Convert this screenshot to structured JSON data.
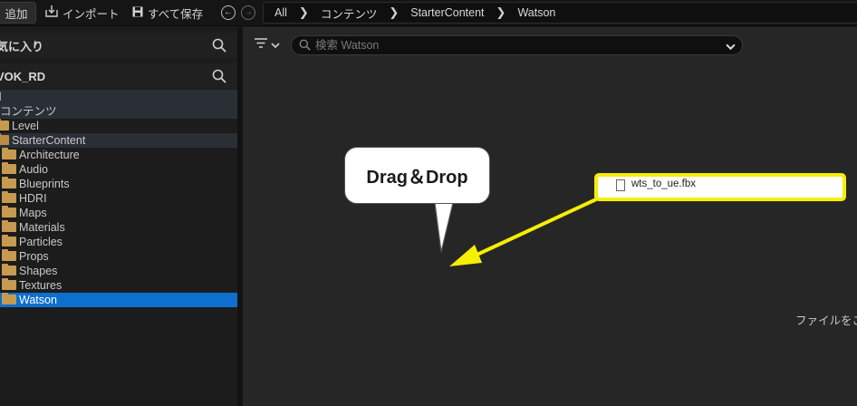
{
  "toolbar": {
    "add_label": "追加",
    "import_label": "インポート",
    "saveall_label": "すべて保存",
    "back_icon": "arrow-left-icon",
    "forward_icon": "arrow-right-icon"
  },
  "breadcrumb": {
    "items": [
      "All",
      "コンテンツ",
      "StarterContent",
      "Watson"
    ],
    "separator": "❯"
  },
  "sidebar": {
    "favorites_title": "気に入り",
    "project_title": "VOK_RD",
    "tree": [
      {
        "label": "ll",
        "type": "root"
      },
      {
        "label": "コンテンツ",
        "type": "root"
      },
      {
        "label": "Level",
        "type": "folder"
      },
      {
        "label": "StarterContent",
        "type": "folder-open"
      },
      {
        "label": "Architecture",
        "type": "folder"
      },
      {
        "label": "Audio",
        "type": "folder"
      },
      {
        "label": "Blueprints",
        "type": "folder"
      },
      {
        "label": "HDRI",
        "type": "folder"
      },
      {
        "label": "Maps",
        "type": "folder"
      },
      {
        "label": "Materials",
        "type": "folder"
      },
      {
        "label": "Particles",
        "type": "folder"
      },
      {
        "label": "Props",
        "type": "folder"
      },
      {
        "label": "Shapes",
        "type": "folder"
      },
      {
        "label": "Textures",
        "type": "folder"
      },
      {
        "label": "Watson",
        "type": "folder",
        "selected": true
      }
    ]
  },
  "content": {
    "search_placeholder": "検索 Watson",
    "empty_hint": "ファイルをこ"
  },
  "overlay": {
    "bubble_text": "Drag＆Drop",
    "file_name": "wts_to_ue.fbx",
    "highlight_color": "#f5ee05",
    "selection_color": "#0d6fce"
  }
}
